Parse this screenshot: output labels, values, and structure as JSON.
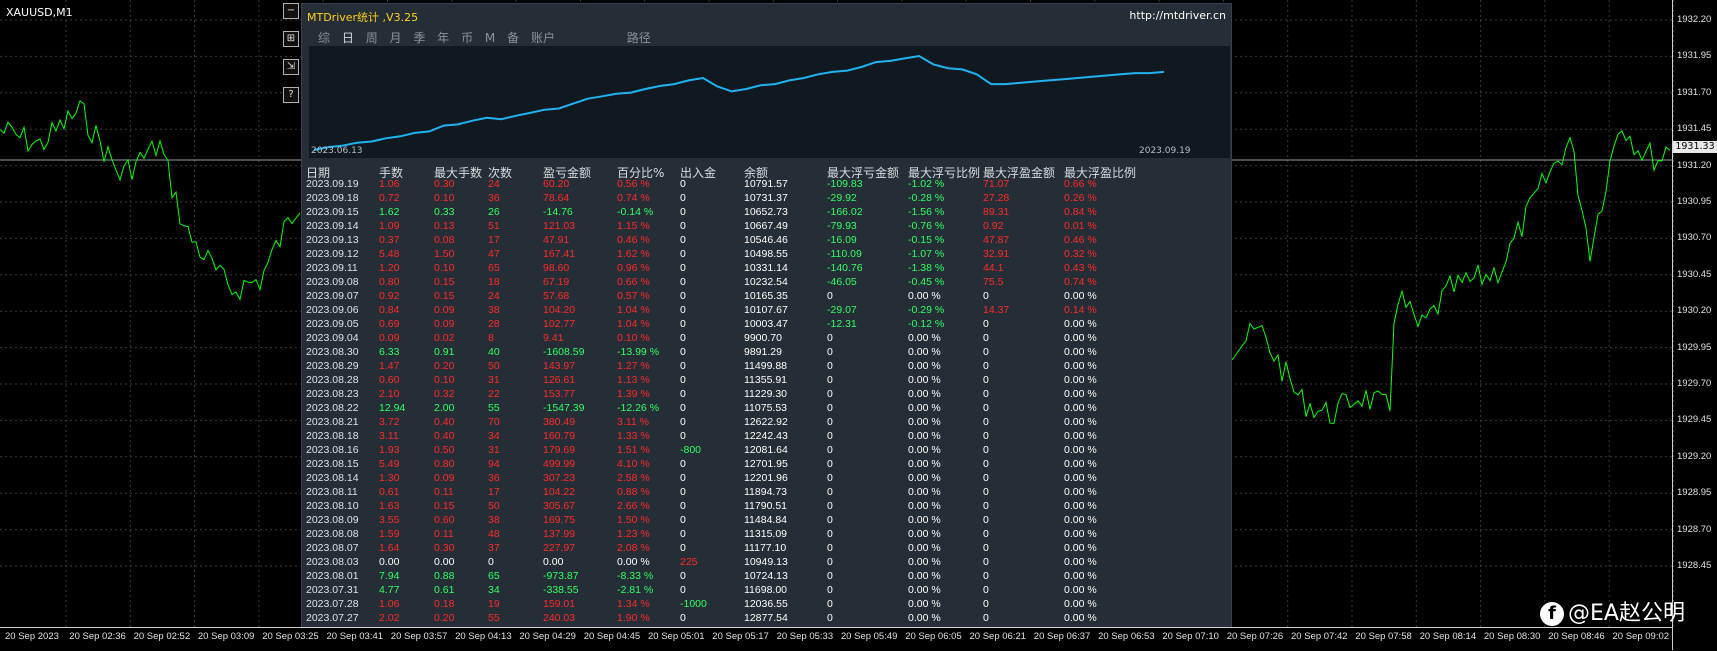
{
  "chart": {
    "symbol": "XAUUSD,M1",
    "current_price": "1931.33",
    "price_labels": [
      "1932.20",
      "1931.95",
      "1931.70",
      "1931.45",
      "1931.20",
      "1930.95",
      "1930.70",
      "1930.45",
      "1930.20",
      "1929.95",
      "1929.70",
      "1929.45",
      "1929.20",
      "1928.95",
      "1928.70",
      "1928.45"
    ],
    "time_labels": [
      "20 Sep 2023",
      "20 Sep 02:36",
      "20 Sep 02:52",
      "20 Sep 03:09",
      "20 Sep 03:25",
      "20 Sep 03:41",
      "20 Sep 03:57",
      "20 Sep 04:13",
      "20 Sep 04:29",
      "20 Sep 04:45",
      "20 Sep 05:01",
      "20 Sep 05:17",
      "20 Sep 05:33",
      "20 Sep 05:49",
      "20 Sep 06:05",
      "20 Sep 06:21",
      "20 Sep 06:37",
      "20 Sep 06:53",
      "20 Sep 07:10",
      "20 Sep 07:26",
      "20 Sep 07:42",
      "20 Sep 07:58",
      "20 Sep 08:14",
      "20 Sep 08:30",
      "20 Sep 08:46",
      "20 Sep 09:02"
    ],
    "line_color": "#00ff00"
  },
  "side_buttons": [
    "−",
    "⊞",
    "⇲",
    "?"
  ],
  "panel": {
    "title": "MTDriver统计 ,V3.25",
    "url": "http://mtdriver.cn",
    "tabs": [
      "综",
      "日",
      "周",
      "月",
      "季",
      "年",
      "币",
      "M",
      "备",
      "账户"
    ],
    "active_tab": "日",
    "route_label": "路径",
    "mini_chart": {
      "start_label": "2023.06.13",
      "end_label": "2023.09.19",
      "line_color": "#1fb4f0",
      "values": [
        10000,
        10120,
        10180,
        10300,
        10350,
        10480,
        10560,
        10700,
        10760,
        11000,
        11050,
        11200,
        11320,
        11260,
        11400,
        11520,
        11650,
        11700,
        11900,
        12100,
        12200,
        12300,
        12350,
        12500,
        12620,
        12700,
        12850,
        12950,
        12600,
        12400,
        12500,
        12650,
        12700,
        12850,
        12950,
        13100,
        13200,
        13250,
        13400,
        13600,
        13650,
        13750,
        13850,
        13500,
        13350,
        13300,
        13100,
        12700,
        12700,
        12750,
        12800,
        12850,
        12900,
        12950,
        13000,
        13050,
        13100,
        13150,
        13150,
        13200
      ]
    },
    "headers": [
      "日期",
      "手数",
      "最大手数",
      "次数",
      "盈亏金额",
      "百分比%",
      "出入金",
      "余额",
      "最大浮亏金额",
      "最大浮亏比例",
      "最大浮盈金额",
      "最大浮盈比例"
    ],
    "rows": [
      {
        "date": "2023.09.19",
        "lots": "1.06",
        "max_lots": "0.30",
        "count": "24",
        "pnl": "60.20",
        "pct": "0.56 %",
        "flow": "0",
        "bal": "10791.57",
        "fl": "-109.83",
        "flp": "-1.02 %",
        "fp": "71.07",
        "fpp": "0.66 %",
        "t": "p"
      },
      {
        "date": "2023.09.18",
        "lots": "0.72",
        "max_lots": "0.10",
        "count": "36",
        "pnl": "78.64",
        "pct": "0.74 %",
        "flow": "0",
        "bal": "10731.37",
        "fl": "-29.92",
        "flp": "-0.28 %",
        "fp": "27.28",
        "fpp": "0.26 %",
        "t": "p"
      },
      {
        "date": "2023.09.15",
        "lots": "1.62",
        "max_lots": "0.33",
        "count": "26",
        "pnl": "-14.76",
        "pct": "-0.14 %",
        "flow": "0",
        "bal": "10652.73",
        "fl": "-166.02",
        "flp": "-1.56 %",
        "fp": "89.31",
        "fpp": "0.84 %",
        "t": "n"
      },
      {
        "date": "2023.09.14",
        "lots": "1.09",
        "max_lots": "0.13",
        "count": "51",
        "pnl": "121.03",
        "pct": "1.15 %",
        "flow": "0",
        "bal": "10667.49",
        "fl": "-79.93",
        "flp": "-0.76 %",
        "fp": "0.92",
        "fpp": "0.01 %",
        "t": "p"
      },
      {
        "date": "2023.09.13",
        "lots": "0.37",
        "max_lots": "0.08",
        "count": "17",
        "pnl": "47.91",
        "pct": "0.46 %",
        "flow": "0",
        "bal": "10546.46",
        "fl": "-16.09",
        "flp": "-0.15 %",
        "fp": "47.87",
        "fpp": "0.46 %",
        "t": "p"
      },
      {
        "date": "2023.09.12",
        "lots": "5.48",
        "max_lots": "1.50",
        "count": "47",
        "pnl": "167.41",
        "pct": "1.62 %",
        "flow": "0",
        "bal": "10498.55",
        "fl": "-110.09",
        "flp": "-1.07 %",
        "fp": "32.91",
        "fpp": "0.32 %",
        "t": "p"
      },
      {
        "date": "2023.09.11",
        "lots": "1.20",
        "max_lots": "0.10",
        "count": "65",
        "pnl": "98.60",
        "pct": "0.96 %",
        "flow": "0",
        "bal": "10331.14",
        "fl": "-140.76",
        "flp": "-1.38 %",
        "fp": "44.1",
        "fpp": "0.43 %",
        "t": "p"
      },
      {
        "date": "2023.09.08",
        "lots": "0.80",
        "max_lots": "0.15",
        "count": "18",
        "pnl": "67.19",
        "pct": "0.66 %",
        "flow": "0",
        "bal": "10232.54",
        "fl": "-46.05",
        "flp": "-0.45 %",
        "fp": "75.5",
        "fpp": "0.74 %",
        "t": "p"
      },
      {
        "date": "2023.09.07",
        "lots": "0.92",
        "max_lots": "0.15",
        "count": "24",
        "pnl": "57.68",
        "pct": "0.57 %",
        "flow": "0",
        "bal": "10165.35",
        "fl": "0",
        "flp": "0.00 %",
        "fp": "0",
        "fpp": "0.00 %",
        "t": "p"
      },
      {
        "date": "2023.09.06",
        "lots": "0.84",
        "max_lots": "0.09",
        "count": "38",
        "pnl": "104.20",
        "pct": "1.04 %",
        "flow": "0",
        "bal": "10107.67",
        "fl": "-29.07",
        "flp": "-0.29 %",
        "fp": "14.37",
        "fpp": "0.14 %",
        "t": "p"
      },
      {
        "date": "2023.09.05",
        "lots": "0.69",
        "max_lots": "0.09",
        "count": "28",
        "pnl": "102.77",
        "pct": "1.04 %",
        "flow": "0",
        "bal": "10003.47",
        "fl": "-12.31",
        "flp": "-0.12 %",
        "fp": "0",
        "fpp": "0.00 %",
        "t": "p"
      },
      {
        "date": "2023.09.04",
        "lots": "0.09",
        "max_lots": "0.02",
        "count": "8",
        "pnl": "9.41",
        "pct": "0.10 %",
        "flow": "0",
        "bal": "9900.70",
        "fl": "0",
        "flp": "0.00 %",
        "fp": "0",
        "fpp": "0.00 %",
        "t": "p"
      },
      {
        "date": "2023.08.30",
        "lots": "6.33",
        "max_lots": "0.91",
        "count": "40",
        "pnl": "-1608.59",
        "pct": "-13.99 %",
        "flow": "0",
        "bal": "9891.29",
        "fl": "0",
        "flp": "0.00 %",
        "fp": "0",
        "fpp": "0.00 %",
        "t": "n"
      },
      {
        "date": "2023.08.29",
        "lots": "1.47",
        "max_lots": "0.20",
        "count": "50",
        "pnl": "143.97",
        "pct": "1.27 %",
        "flow": "0",
        "bal": "11499.88",
        "fl": "0",
        "flp": "0.00 %",
        "fp": "0",
        "fpp": "0.00 %",
        "t": "p"
      },
      {
        "date": "2023.08.28",
        "lots": "0.60",
        "max_lots": "0.10",
        "count": "31",
        "pnl": "126.61",
        "pct": "1.13 %",
        "flow": "0",
        "bal": "11355.91",
        "fl": "0",
        "flp": "0.00 %",
        "fp": "0",
        "fpp": "0.00 %",
        "t": "p"
      },
      {
        "date": "2023.08.23",
        "lots": "2.10",
        "max_lots": "0.32",
        "count": "22",
        "pnl": "153.77",
        "pct": "1.39 %",
        "flow": "0",
        "bal": "11229.30",
        "fl": "0",
        "flp": "0.00 %",
        "fp": "0",
        "fpp": "0.00 %",
        "t": "p"
      },
      {
        "date": "2023.08.22",
        "lots": "12.94",
        "max_lots": "2.00",
        "count": "55",
        "pnl": "-1547.39",
        "pct": "-12.26 %",
        "flow": "0",
        "bal": "11075.53",
        "fl": "0",
        "flp": "0.00 %",
        "fp": "0",
        "fpp": "0.00 %",
        "t": "n"
      },
      {
        "date": "2023.08.21",
        "lots": "3.72",
        "max_lots": "0.40",
        "count": "70",
        "pnl": "380.49",
        "pct": "3.11 %",
        "flow": "0",
        "bal": "12622.92",
        "fl": "0",
        "flp": "0.00 %",
        "fp": "0",
        "fpp": "0.00 %",
        "t": "p"
      },
      {
        "date": "2023.08.18",
        "lots": "3.11",
        "max_lots": "0.40",
        "count": "34",
        "pnl": "160.79",
        "pct": "1.33 %",
        "flow": "0",
        "bal": "12242.43",
        "fl": "0",
        "flp": "0.00 %",
        "fp": "0",
        "fpp": "0.00 %",
        "t": "p"
      },
      {
        "date": "2023.08.16",
        "lots": "1.93",
        "max_lots": "0.50",
        "count": "31",
        "pnl": "179.69",
        "pct": "1.51 %",
        "flow": "-800",
        "bal": "12081.64",
        "fl": "0",
        "flp": "0.00 %",
        "fp": "0",
        "fpp": "0.00 %",
        "t": "p",
        "flow_t": "n"
      },
      {
        "date": "2023.08.15",
        "lots": "5.49",
        "max_lots": "0.80",
        "count": "94",
        "pnl": "499.99",
        "pct": "4.10 %",
        "flow": "0",
        "bal": "12701.95",
        "fl": "0",
        "flp": "0.00 %",
        "fp": "0",
        "fpp": "0.00 %",
        "t": "p"
      },
      {
        "date": "2023.08.14",
        "lots": "1.30",
        "max_lots": "0.09",
        "count": "36",
        "pnl": "307.23",
        "pct": "2.58 %",
        "flow": "0",
        "bal": "12201.96",
        "fl": "0",
        "flp": "0.00 %",
        "fp": "0",
        "fpp": "0.00 %",
        "t": "p"
      },
      {
        "date": "2023.08.11",
        "lots": "0.61",
        "max_lots": "0.11",
        "count": "17",
        "pnl": "104.22",
        "pct": "0.88 %",
        "flow": "0",
        "bal": "11894.73",
        "fl": "0",
        "flp": "0.00 %",
        "fp": "0",
        "fpp": "0.00 %",
        "t": "p"
      },
      {
        "date": "2023.08.10",
        "lots": "1.63",
        "max_lots": "0.15",
        "count": "50",
        "pnl": "305.67",
        "pct": "2.66 %",
        "flow": "0",
        "bal": "11790.51",
        "fl": "0",
        "flp": "0.00 %",
        "fp": "0",
        "fpp": "0.00 %",
        "t": "p"
      },
      {
        "date": "2023.08.09",
        "lots": "3.55",
        "max_lots": "0.60",
        "count": "38",
        "pnl": "169.75",
        "pct": "1.50 %",
        "flow": "0",
        "bal": "11484.84",
        "fl": "0",
        "flp": "0.00 %",
        "fp": "0",
        "fpp": "0.00 %",
        "t": "p"
      },
      {
        "date": "2023.08.08",
        "lots": "1.59",
        "max_lots": "0.11",
        "count": "48",
        "pnl": "137.99",
        "pct": "1.23 %",
        "flow": "0",
        "bal": "11315.09",
        "fl": "0",
        "flp": "0.00 %",
        "fp": "0",
        "fpp": "0.00 %",
        "t": "p"
      },
      {
        "date": "2023.08.07",
        "lots": "1.64",
        "max_lots": "0.30",
        "count": "37",
        "pnl": "227.97",
        "pct": "2.08 %",
        "flow": "0",
        "bal": "11177.10",
        "fl": "0",
        "flp": "0.00 %",
        "fp": "0",
        "fpp": "0.00 %",
        "t": "p"
      },
      {
        "date": "2023.08.03",
        "lots": "0.00",
        "max_lots": "0.00",
        "count": "0",
        "pnl": "0.00",
        "pct": "0.00 %",
        "flow": "225",
        "bal": "10949.13",
        "fl": "0",
        "flp": "0.00 %",
        "fp": "0",
        "fpp": "0.00 %",
        "t": "z",
        "flow_t": "p"
      },
      {
        "date": "2023.08.01",
        "lots": "7.94",
        "max_lots": "0.88",
        "count": "65",
        "pnl": "-973.87",
        "pct": "-8.33 %",
        "flow": "0",
        "bal": "10724.13",
        "fl": "0",
        "flp": "0.00 %",
        "fp": "0",
        "fpp": "0.00 %",
        "t": "n"
      },
      {
        "date": "2023.07.31",
        "lots": "4.77",
        "max_lots": "0.61",
        "count": "34",
        "pnl": "-338.55",
        "pct": "-2.81 %",
        "flow": "0",
        "bal": "11698.00",
        "fl": "0",
        "flp": "0.00 %",
        "fp": "0",
        "fpp": "0.00 %",
        "t": "n"
      },
      {
        "date": "2023.07.28",
        "lots": "1.06",
        "max_lots": "0.18",
        "count": "19",
        "pnl": "159.01",
        "pct": "1.34 %",
        "flow": "-1000",
        "bal": "12036.55",
        "fl": "0",
        "flp": "0.00 %",
        "fp": "0",
        "fpp": "0.00 %",
        "t": "p",
        "flow_t": "n"
      },
      {
        "date": "2023.07.27",
        "lots": "2.02",
        "max_lots": "0.20",
        "count": "55",
        "pnl": "240.03",
        "pct": "1.90 %",
        "flow": "0",
        "bal": "12877.54",
        "fl": "0",
        "flp": "0.00 %",
        "fp": "0",
        "fpp": "0.00 %",
        "t": "p"
      }
    ]
  },
  "watermark": {
    "icon": "facebook-icon",
    "text": "@EA赵公明"
  }
}
